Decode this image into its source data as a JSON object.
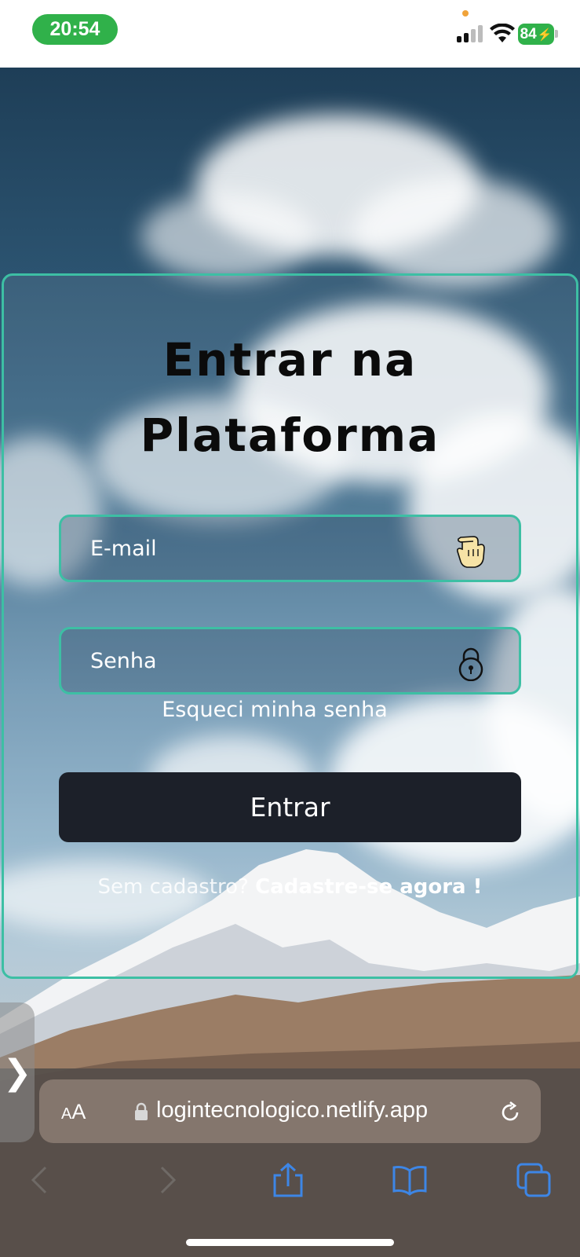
{
  "status_bar": {
    "time": "20:54",
    "battery": "84"
  },
  "login": {
    "title_line1": "Entrar na",
    "title_line2": "Plataforma",
    "email_placeholder": "E-mail",
    "password_placeholder": "Senha",
    "forgot_password": "Esqueci minha senha",
    "submit_label": "Entrar",
    "signup_prompt": "Sem cadastro?",
    "signup_link": "Cadastre-se agora !"
  },
  "browser": {
    "text_size_label_small": "A",
    "text_size_label_large": "A",
    "url": "logintecnologico.netlify.app",
    "side_tab_glyph": "❯"
  },
  "colors": {
    "accent": "#3dbfa4",
    "button_bg": "#1c2029",
    "status_green": "#30b14a",
    "safari_icon_blue": "#3d86e6"
  },
  "icons": [
    "hand-pointer-icon",
    "padlock-icon",
    "lock-icon",
    "reload-icon",
    "back-icon",
    "forward-icon",
    "share-icon",
    "bookmarks-icon",
    "tabs-icon",
    "chevron-right-icon"
  ]
}
